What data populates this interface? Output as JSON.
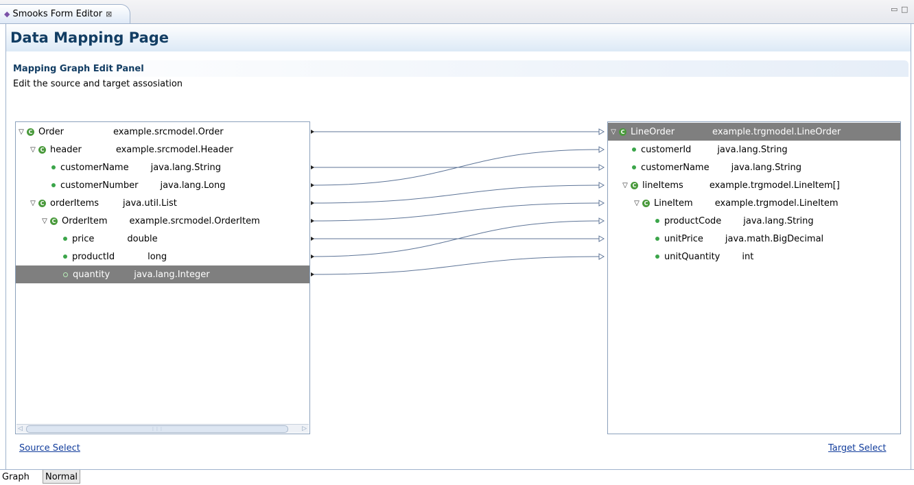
{
  "editor_tab": {
    "title": "Smooks Form Editor",
    "close_glyph": "⊠",
    "icon": "smooks-icon"
  },
  "window_controls": {
    "minimize": "▭",
    "maximize": "□"
  },
  "page": {
    "title": "Data Mapping Page"
  },
  "section": {
    "title": "Mapping Graph Edit Panel",
    "description": "Edit the source and target assosiation"
  },
  "source_tree": [
    {
      "name": "Order",
      "type": "example.srcmodel.Order",
      "kind": "class",
      "depth": 0,
      "expanded": true,
      "selected": false
    },
    {
      "name": "header",
      "type": "example.srcmodel.Header",
      "kind": "class",
      "depth": 1,
      "expanded": true,
      "selected": false
    },
    {
      "name": "customerName",
      "type": "java.lang.String",
      "kind": "field",
      "depth": 2,
      "selected": false
    },
    {
      "name": "customerNumber",
      "type": "java.lang.Long",
      "kind": "field",
      "depth": 2,
      "selected": false
    },
    {
      "name": "orderItems",
      "type": "java.util.List",
      "kind": "class",
      "depth": 1,
      "expanded": true,
      "selected": false
    },
    {
      "name": "OrderItem",
      "type": "example.srcmodel.OrderItem",
      "kind": "class",
      "depth": 2,
      "expanded": true,
      "selected": false
    },
    {
      "name": "price",
      "type": "double",
      "kind": "field",
      "depth": 3,
      "selected": false
    },
    {
      "name": "productId",
      "type": "long",
      "kind": "field",
      "depth": 3,
      "selected": false
    },
    {
      "name": "quantity",
      "type": "java.lang.Integer",
      "kind": "field",
      "depth": 3,
      "selected": true
    }
  ],
  "target_tree": [
    {
      "name": "LineOrder",
      "type": "example.trgmodel.LineOrder",
      "kind": "class",
      "depth": 0,
      "expanded": true,
      "selected": true
    },
    {
      "name": "customerId",
      "type": "java.lang.String",
      "kind": "field",
      "depth": 1,
      "selected": false
    },
    {
      "name": "customerName",
      "type": "java.lang.String",
      "kind": "field",
      "depth": 1,
      "selected": false
    },
    {
      "name": "lineItems",
      "type": "example.trgmodel.LineItem[]",
      "kind": "class",
      "depth": 1,
      "expanded": true,
      "selected": false
    },
    {
      "name": "LineItem",
      "type": "example.trgmodel.LineItem",
      "kind": "class",
      "depth": 2,
      "expanded": true,
      "selected": false
    },
    {
      "name": "productCode",
      "type": "java.lang.String",
      "kind": "field",
      "depth": 3,
      "selected": false
    },
    {
      "name": "unitPrice",
      "type": "java.math.BigDecimal",
      "kind": "field",
      "depth": 3,
      "selected": false
    },
    {
      "name": "unitQuantity",
      "type": "int",
      "kind": "field",
      "depth": 3,
      "selected": false
    }
  ],
  "mappings": [
    {
      "source": "Order",
      "target": "LineOrder"
    },
    {
      "source": "customerName",
      "target": "customerName"
    },
    {
      "source": "customerNumber",
      "target": "customerId"
    },
    {
      "source": "orderItems",
      "target": "lineItems"
    },
    {
      "source": "OrderItem",
      "target": "LineItem"
    },
    {
      "source": "price",
      "target": "unitPrice"
    },
    {
      "source": "productId",
      "target": "productCode"
    },
    {
      "source": "quantity",
      "target": "unitQuantity"
    }
  ],
  "links": {
    "source_select": "Source Select",
    "target_select": "Target Select"
  },
  "bottom_tabs": [
    {
      "label": "Graph",
      "active": true
    },
    {
      "label": "Normal",
      "active": false
    }
  ],
  "colors": {
    "title": "#123d63",
    "selection": "#7f7f7f",
    "connection": "#5c7396",
    "link": "#123d9c"
  }
}
